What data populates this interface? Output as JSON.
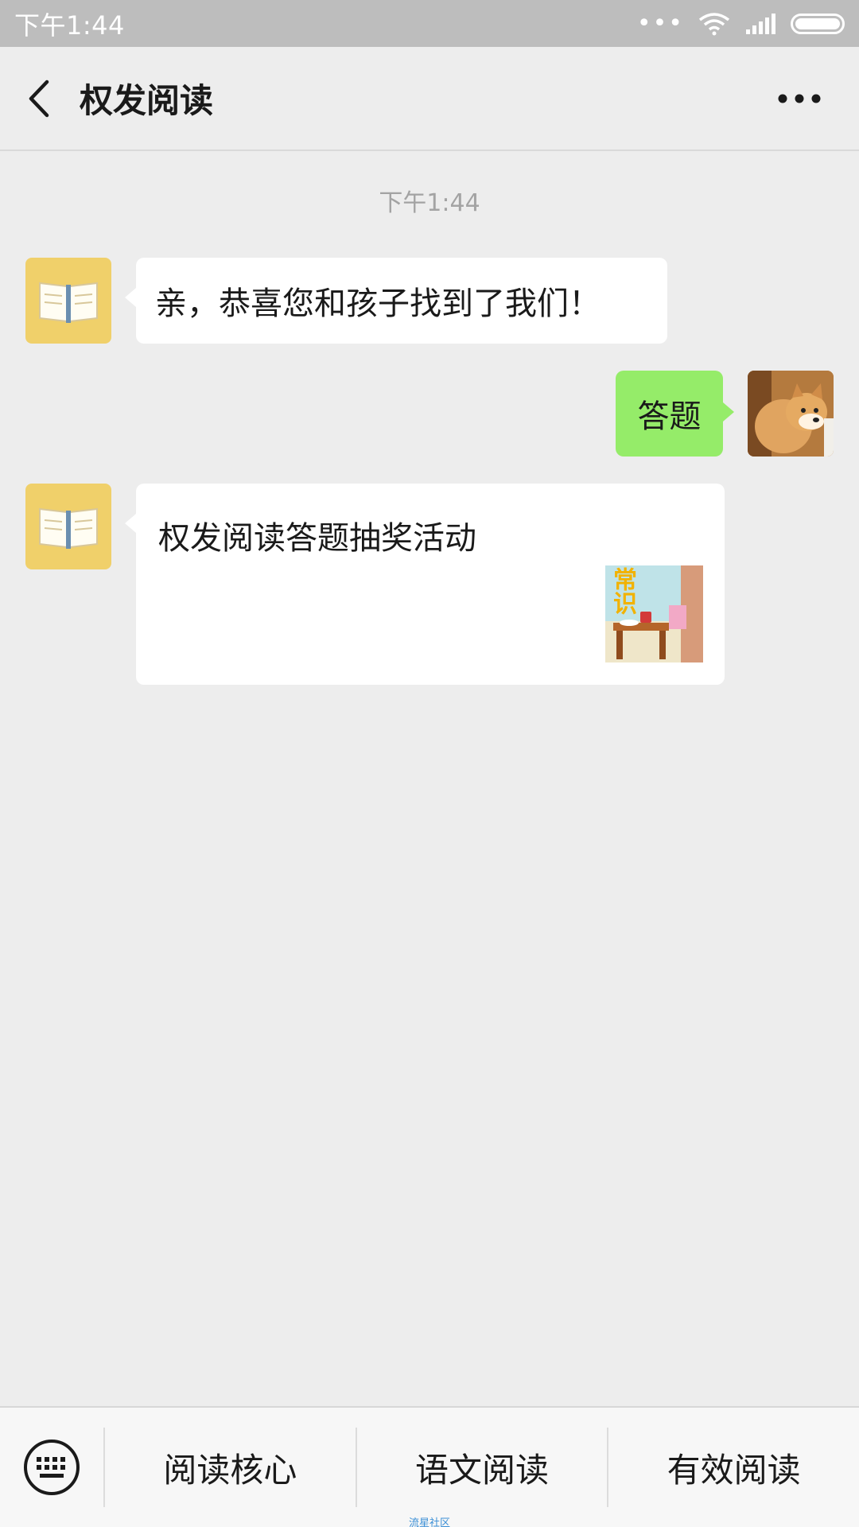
{
  "status_bar": {
    "time": "下午1:44",
    "icons": [
      "more-dots-icon",
      "wifi-icon",
      "signal-icon",
      "battery-icon"
    ]
  },
  "nav": {
    "title": "权发阅读",
    "back_icon": "chevron-left-icon",
    "more_icon": "more-icon"
  },
  "chat": {
    "timestamp": "下午1:44",
    "messages": [
      {
        "from": "official",
        "text": "亲，恭喜您和孩子找到了我们！"
      },
      {
        "from": "me",
        "text": "答题"
      },
      {
        "from": "official",
        "type": "link-card",
        "title": "权发阅读答题抽奖活动",
        "thumb_text": "常识"
      }
    ]
  },
  "bottom_menu": {
    "keyboard_icon": "keyboard-icon",
    "items": [
      "阅读核心",
      "语文阅读",
      "有效阅读"
    ]
  },
  "watermark": "流星社区",
  "colors": {
    "status_bar": "#bdbdbd",
    "background": "#ededed",
    "my_bubble": "#95ec69",
    "official_avatar": "#f0d06a"
  }
}
